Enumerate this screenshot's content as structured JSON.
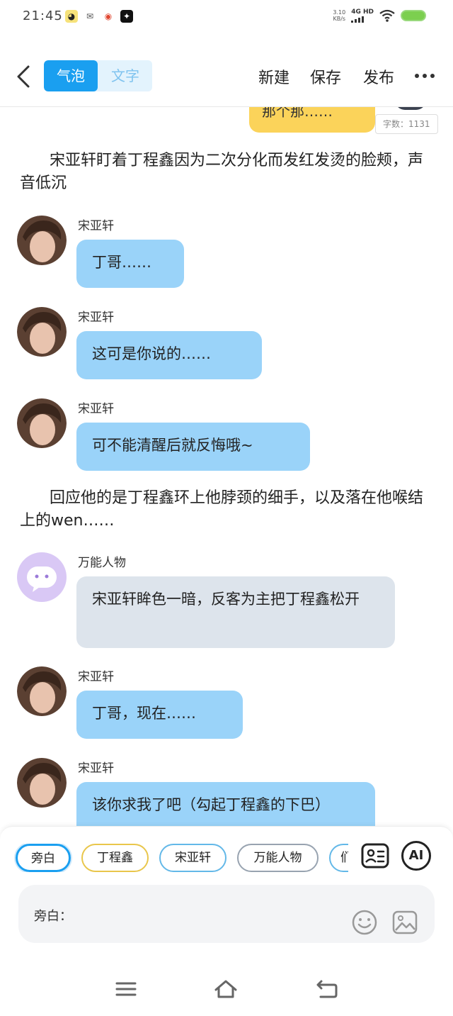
{
  "status_bar": {
    "time": "21:45",
    "net_speed_value": "3.10",
    "net_speed_unit": "KB/s",
    "network": "4G HD"
  },
  "header": {
    "tab_bubble": "气泡",
    "tab_text": "文字",
    "new_label": "新建",
    "save_label": "保存",
    "publish_label": "发布"
  },
  "chat": {
    "prev_bubble_text": "那个那……",
    "word_count": "字数：1131",
    "narration_1": "宋亚轩盯着丁程鑫因为二次分化而发红发烫的脸颊，声音低沉",
    "messages": [
      {
        "sender": "宋亚轩",
        "text": "丁哥……"
      },
      {
        "sender": "宋亚轩",
        "text": "这可是你说的……"
      },
      {
        "sender": "宋亚轩",
        "text": "可不能清醒后就反悔哦~"
      }
    ],
    "narration_2": "回应他的是丁程鑫环上他脖颈的细手，以及落在他喉结上的wen……",
    "messages_2": [
      {
        "sender": "万能人物",
        "text": "宋亚轩眸色一暗，反客为主把丁程鑫松开"
      },
      {
        "sender": "宋亚轩",
        "text": "丁哥，现在……"
      },
      {
        "sender": "宋亚轩",
        "text": "该你求我了吧（勾起丁程鑫的下巴）"
      }
    ]
  },
  "composer": {
    "chips": [
      "旁白",
      "丁程鑫",
      "宋亚轩",
      "万能人物",
      "们"
    ],
    "ai_label": "AI",
    "input_label": "旁白："
  },
  "colors": {
    "accent_blue": "#1a9ff0",
    "bubble_blue": "#9ad3f9",
    "bubble_grey": "#dde4ec",
    "bubble_yellow": "#fbd35a"
  }
}
